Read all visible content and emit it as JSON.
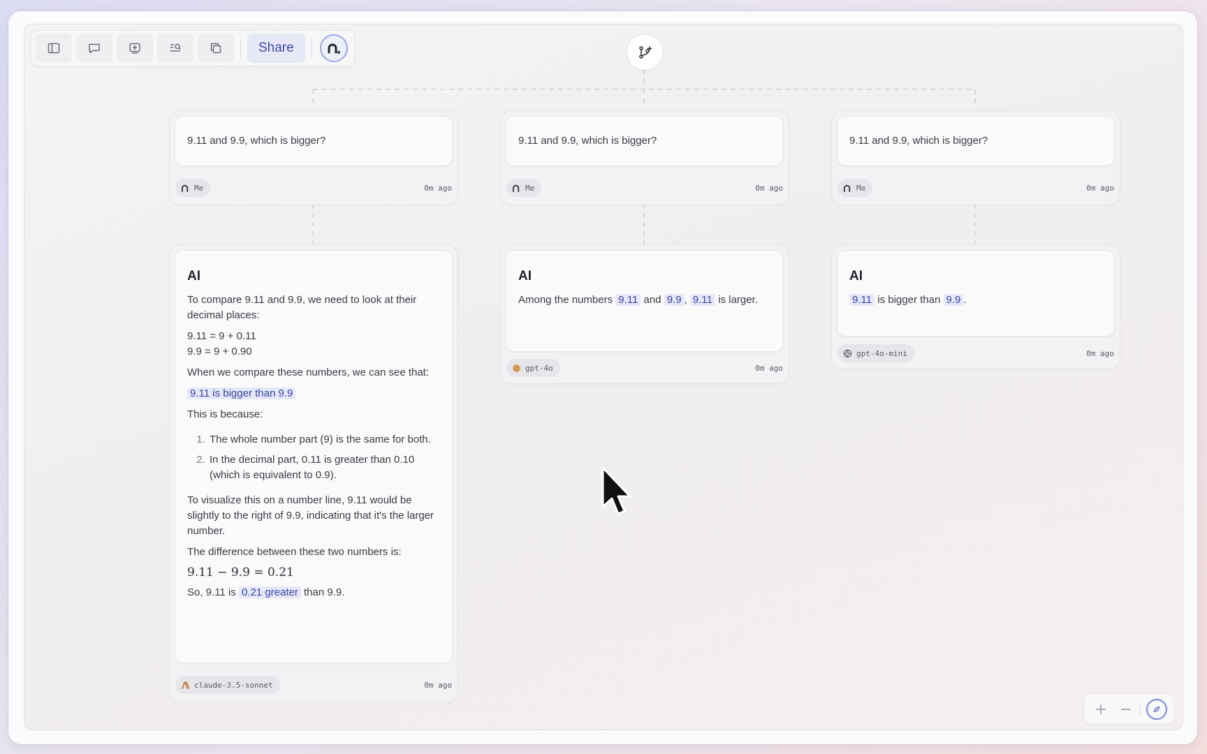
{
  "toolbar": {
    "buttons": [
      {
        "name": "sidebar-toggle-button",
        "icon": "sidebar-icon"
      },
      {
        "name": "comment-button",
        "icon": "chat-bubble-icon"
      },
      {
        "name": "add-card-button",
        "icon": "add-box-icon"
      },
      {
        "name": "search-button",
        "icon": "search-list-icon"
      },
      {
        "name": "copy-button",
        "icon": "copy-icon"
      }
    ],
    "share_label": "Share",
    "avatar_icon": "user-avatar-icon"
  },
  "branch_button": {
    "icon": "branch-plus-icon"
  },
  "columns": [
    {
      "question": "9.11 and 9.9, which is bigger?",
      "question_author": "Me",
      "question_time": "0m ago",
      "answer_title": "AI",
      "answer": {
        "p1": "To compare 9.11 and 9.9, we need to look at their decimal places:",
        "eq1": "9.11 = 9 + 0.11",
        "eq2": "9.9 = 9 + 0.90",
        "p2": "When we compare these numbers, we can see that:",
        "highlight": "9.11 is bigger than 9.9",
        "p3": "This is because:",
        "list": [
          "The whole number part (9) is the same for both.",
          "In the decimal part, 0.11 is greater than 0.10 (which is equivalent to 0.9)."
        ],
        "p4": "To visualize this on a number line, 9.11 would be slightly to the right of 9.9, indicating that it's the larger number.",
        "p5": "The difference between these two numbers is:",
        "math": "9.11 − 9.9 = 0.21",
        "p6_before": "So, 9.11 is ",
        "p6_highlight": "0.21 greater",
        "p6_after": " than 9.9."
      },
      "model": "claude-3.5-sonnet",
      "model_icon": "anthropic-logo-icon",
      "answer_time": "0m ago"
    },
    {
      "question": "9.11 and 9.9, which is bigger?",
      "question_author": "Me",
      "question_time": "0m ago",
      "answer_title": "AI",
      "answer": {
        "t1": "Among the numbers ",
        "h1": "9.11",
        "t2": " and ",
        "h2": "9.9",
        "t3": ", ",
        "h3": "9.11",
        "t4": " is larger."
      },
      "model": "gpt-4o",
      "model_icon": "openai-logo-icon",
      "answer_time": "0m ago"
    },
    {
      "question": "9.11 and 9.9, which is bigger?",
      "question_author": "Me",
      "question_time": "0m ago",
      "answer_title": "AI",
      "answer": {
        "h1": "9.11",
        "t1": " is bigger than ",
        "h2": "9.9",
        "t2": "."
      },
      "model": "gpt-4o-mini",
      "model_icon": "openai-logo-icon",
      "answer_time": "0m ago"
    }
  ],
  "zoom": {
    "zoom_in": "+",
    "zoom_out": "−",
    "fit_icon": "compass-icon"
  },
  "colors": {
    "accent": "#3f49a8",
    "highlight_bg": "#e6e8f7"
  }
}
